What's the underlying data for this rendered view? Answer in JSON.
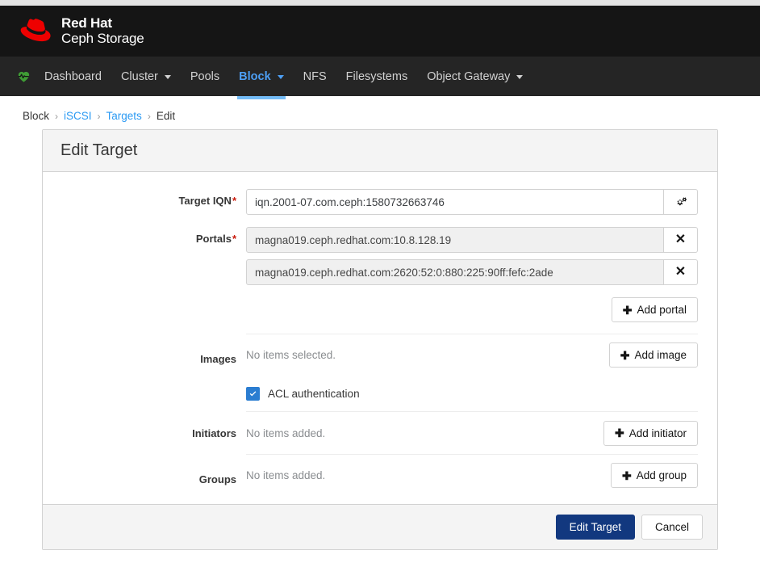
{
  "masthead": {
    "brand_line1": "Red Hat",
    "brand_line2": "Ceph Storage",
    "logo_icon": "redhat-fedora-logo",
    "bg_color": "#151515"
  },
  "navbar": {
    "bg_color": "#252525",
    "active_color": "#4d9ff5",
    "underline_color": "#73bcf7",
    "health_icon": "heartbeat-icon",
    "items": [
      {
        "label": "Dashboard",
        "has_caret": false,
        "active": false
      },
      {
        "label": "Cluster",
        "has_caret": true,
        "active": false
      },
      {
        "label": "Pools",
        "has_caret": false,
        "active": false
      },
      {
        "label": "Block",
        "has_caret": true,
        "active": true
      },
      {
        "label": "NFS",
        "has_caret": false,
        "active": false
      },
      {
        "label": "Filesystems",
        "has_caret": false,
        "active": false
      },
      {
        "label": "Object Gateway",
        "has_caret": true,
        "active": false
      }
    ]
  },
  "breadcrumb": {
    "separator": "›",
    "link_color": "#2b9af3",
    "items": [
      {
        "label": "Block",
        "link": false
      },
      {
        "label": "iSCSI",
        "link": true
      },
      {
        "label": "Targets",
        "link": true
      },
      {
        "label": "Edit",
        "link": false
      }
    ]
  },
  "card": {
    "title": "Edit Target",
    "form": {
      "target_iqn": {
        "label": "Target IQN",
        "required_marker": "*",
        "value": "iqn.2001-07.com.ceph:1580732663746",
        "addon_icon": "cogs-icon"
      },
      "portals": {
        "label": "Portals",
        "required_marker": "*",
        "remove_icon": "times-icon",
        "values": [
          "magna019.ceph.redhat.com:10.8.128.19",
          "magna019.ceph.redhat.com:2620:52:0:880:225:90ff:fefc:2ade"
        ],
        "add_button": {
          "label": "Add portal",
          "icon": "plus-icon"
        }
      },
      "images": {
        "label": "Images",
        "empty_text": "No items selected.",
        "add_button": {
          "label": "Add image",
          "icon": "plus-icon"
        }
      },
      "acl_authentication": {
        "label": "ACL authentication",
        "checked": true,
        "checkbox_color": "#2b7dd1",
        "check_icon": "check-icon"
      },
      "initiators": {
        "label": "Initiators",
        "empty_text": "No items added.",
        "add_button": {
          "label": "Add initiator",
          "icon": "plus-icon"
        }
      },
      "groups": {
        "label": "Groups",
        "empty_text": "No items added.",
        "add_button": {
          "label": "Add group",
          "icon": "plus-icon"
        }
      }
    },
    "footer": {
      "submit_label": "Edit Target",
      "submit_color": "#12387f",
      "cancel_label": "Cancel"
    }
  }
}
